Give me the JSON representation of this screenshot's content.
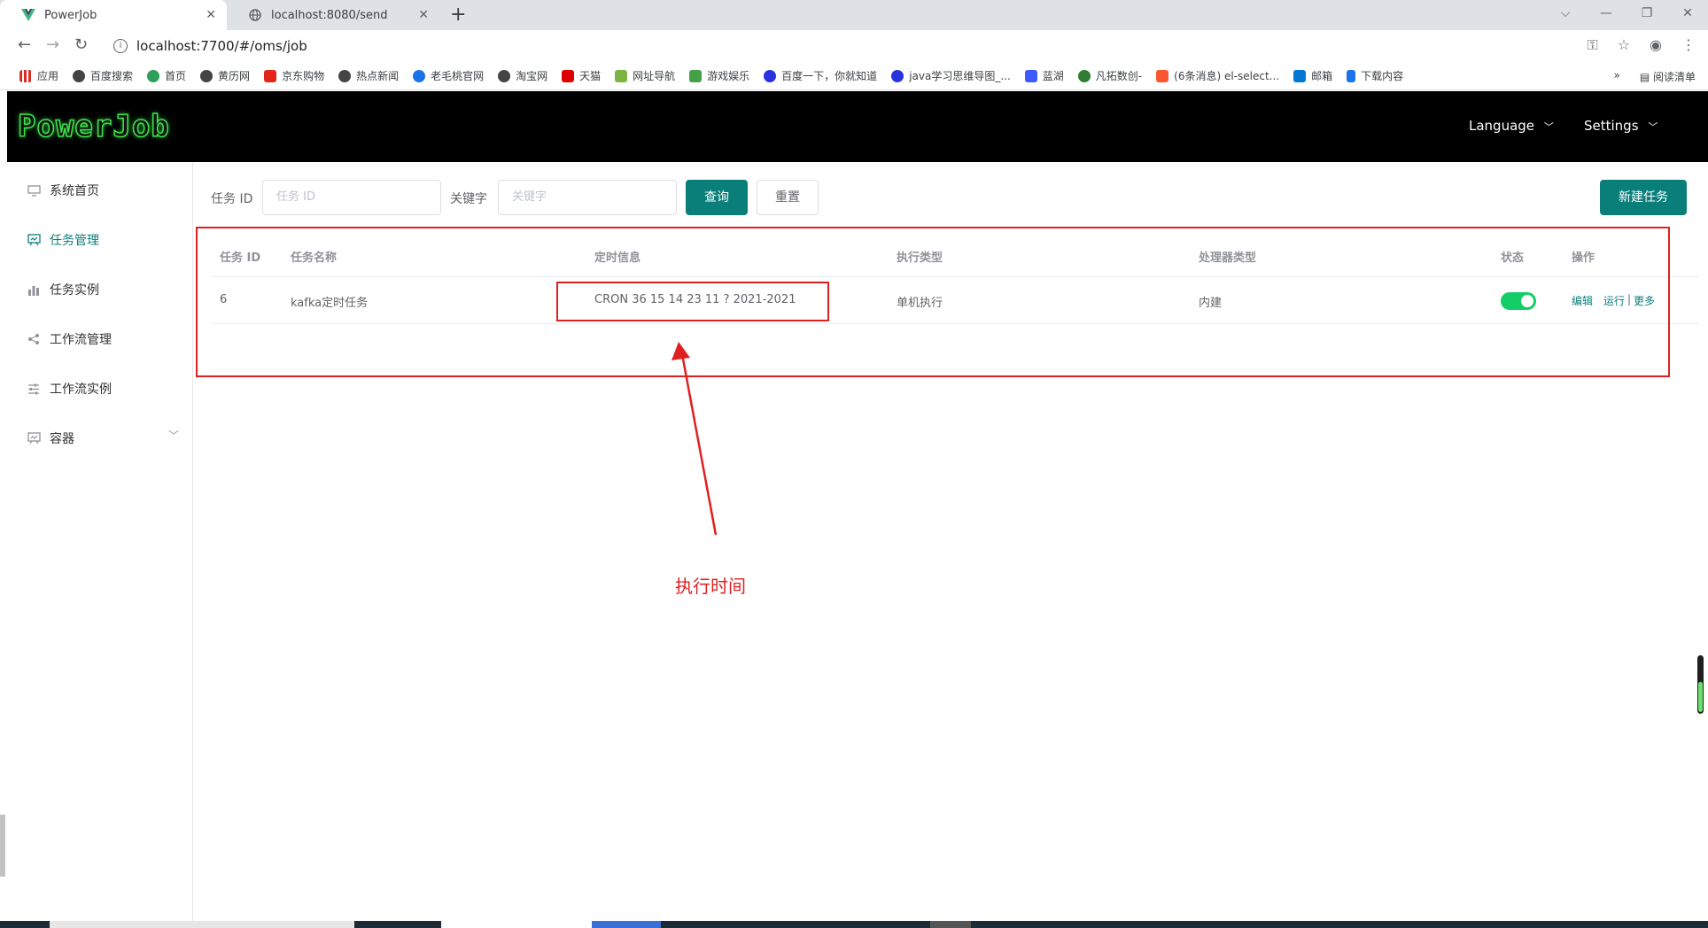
{
  "browser": {
    "tabs": [
      {
        "title": "PowerJob",
        "active": true
      },
      {
        "title": "localhost:8080/send",
        "active": false
      }
    ],
    "url": "localhost:7700/#/oms/job",
    "bookmarks": [
      "应用",
      "百度搜索",
      "首页",
      "黄历网",
      "京东购物",
      "热点新闻",
      "老毛桃官网",
      "淘宝网",
      "天猫",
      "网址导航",
      "游戏娱乐",
      "百度一下，你就知道",
      "java学习思维导图_...",
      "蓝湖",
      "凡拓数创-",
      "(6条消息) el-select...",
      "邮箱",
      "下载内容"
    ],
    "reading_list": "阅读清单",
    "more": "»"
  },
  "header": {
    "logo": "PowerJob",
    "language": "Language",
    "settings": "Settings"
  },
  "sidebar": {
    "items": [
      {
        "label": "系统首页",
        "icon": "monitor-icon"
      },
      {
        "label": "任务管理",
        "icon": "task-board-icon",
        "active": true
      },
      {
        "label": "任务实例",
        "icon": "bar-chart-icon"
      },
      {
        "label": "工作流管理",
        "icon": "share-icon"
      },
      {
        "label": "工作流实例",
        "icon": "sliders-icon"
      },
      {
        "label": "容器",
        "icon": "container-icon"
      }
    ]
  },
  "search": {
    "task_id_label": "任务 ID",
    "task_id_placeholder": "任务 ID",
    "keyword_label": "关键字",
    "keyword_placeholder": "关键字",
    "query_button": "查询",
    "reset_button": "重置",
    "new_task_button": "新建任务"
  },
  "table": {
    "headers": [
      "任务 ID",
      "任务名称",
      "定时信息",
      "执行类型",
      "处理器类型",
      "状态",
      "操作"
    ],
    "rows": [
      {
        "id": "6",
        "name": "kafka定时任务",
        "schedule": "CRON 36 15 14 23 11 ? 2021-2021",
        "exec_type": "单机执行",
        "processor_type": "内建",
        "status_enabled": true,
        "ops": [
          "编辑",
          "运行",
          "|",
          "更多"
        ]
      }
    ]
  },
  "annotation": {
    "text": "执行时间",
    "color": "#e02020"
  },
  "colors": {
    "primary": "#0a7f7a",
    "switch_on": "#13ce66",
    "logo_green": "#3ee24b"
  }
}
